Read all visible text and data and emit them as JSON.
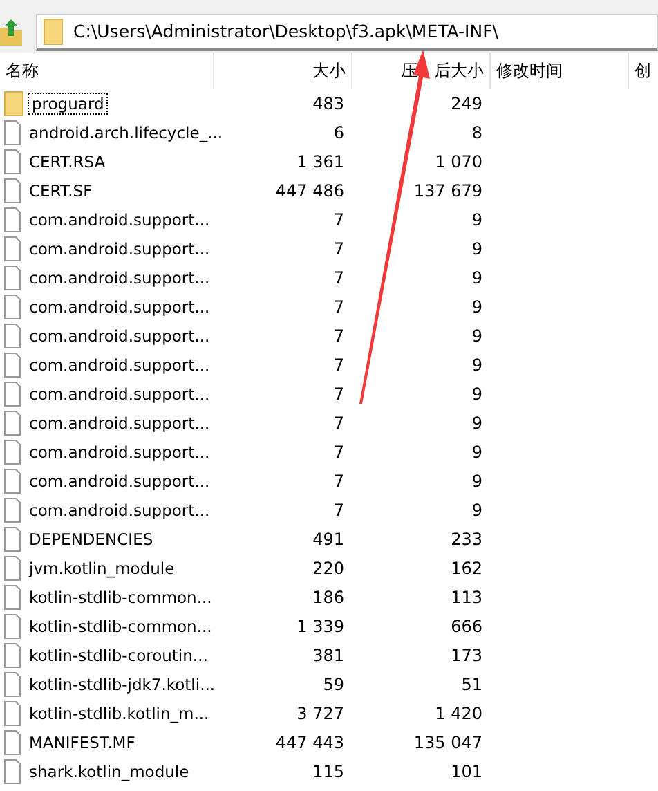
{
  "address_bar": {
    "path": "C:\\Users\\Administrator\\Desktop\\f3.apk\\META-INF\\"
  },
  "table": {
    "columns": [
      "名称",
      "大小",
      "压　后大小",
      "修改时间",
      "创"
    ],
    "rows": [
      {
        "kind": "folder",
        "name": "proguard",
        "size": "483",
        "packed": "249",
        "focused": true
      },
      {
        "kind": "file",
        "name": "android.arch.lifecycle_...",
        "size": "6",
        "packed": "8",
        "focused": false
      },
      {
        "kind": "file",
        "name": "CERT.RSA",
        "size": "1 361",
        "packed": "1 070",
        "focused": false
      },
      {
        "kind": "file",
        "name": "CERT.SF",
        "size": "447 486",
        "packed": "137 679",
        "focused": false
      },
      {
        "kind": "file",
        "name": "com.android.support...",
        "size": "7",
        "packed": "9",
        "focused": false
      },
      {
        "kind": "file",
        "name": "com.android.support...",
        "size": "7",
        "packed": "9",
        "focused": false
      },
      {
        "kind": "file",
        "name": "com.android.support...",
        "size": "7",
        "packed": "9",
        "focused": false
      },
      {
        "kind": "file",
        "name": "com.android.support...",
        "size": "7",
        "packed": "9",
        "focused": false
      },
      {
        "kind": "file",
        "name": "com.android.support...",
        "size": "7",
        "packed": "9",
        "focused": false
      },
      {
        "kind": "file",
        "name": "com.android.support...",
        "size": "7",
        "packed": "9",
        "focused": false
      },
      {
        "kind": "file",
        "name": "com.android.support...",
        "size": "7",
        "packed": "9",
        "focused": false
      },
      {
        "kind": "file",
        "name": "com.android.support...",
        "size": "7",
        "packed": "9",
        "focused": false
      },
      {
        "kind": "file",
        "name": "com.android.support...",
        "size": "7",
        "packed": "9",
        "focused": false
      },
      {
        "kind": "file",
        "name": "com.android.support...",
        "size": "7",
        "packed": "9",
        "focused": false
      },
      {
        "kind": "file",
        "name": "com.android.support...",
        "size": "7",
        "packed": "9",
        "focused": false
      },
      {
        "kind": "file",
        "name": "DEPENDENCIES",
        "size": "491",
        "packed": "233",
        "focused": false
      },
      {
        "kind": "file",
        "name": "jvm.kotlin_module",
        "size": "220",
        "packed": "162",
        "focused": false
      },
      {
        "kind": "file",
        "name": "kotlin-stdlib-common...",
        "size": "186",
        "packed": "113",
        "focused": false
      },
      {
        "kind": "file",
        "name": "kotlin-stdlib-common...",
        "size": "1 339",
        "packed": "666",
        "focused": false
      },
      {
        "kind": "file",
        "name": "kotlin-stdlib-coroutin...",
        "size": "381",
        "packed": "173",
        "focused": false
      },
      {
        "kind": "file",
        "name": "kotlin-stdlib-jdk7.kotli...",
        "size": "59",
        "packed": "51",
        "focused": false
      },
      {
        "kind": "file",
        "name": "kotlin-stdlib.kotlin_m...",
        "size": "3 727",
        "packed": "1 420",
        "focused": false
      },
      {
        "kind": "file",
        "name": "MANIFEST.MF",
        "size": "447 443",
        "packed": "135 047",
        "focused": false
      },
      {
        "kind": "file",
        "name": "shark.kotlin_module",
        "size": "115",
        "packed": "101",
        "focused": false
      }
    ]
  }
}
